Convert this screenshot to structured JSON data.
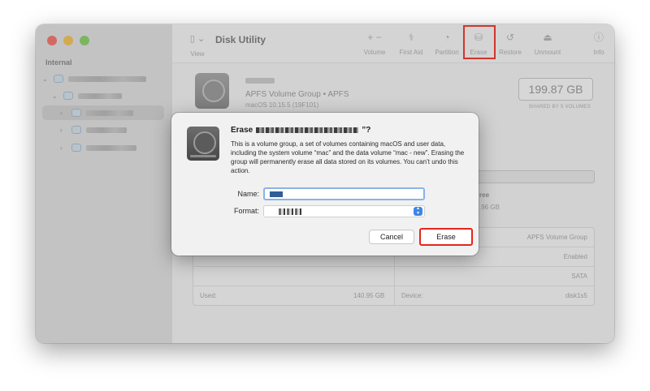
{
  "app": {
    "title": "Disk Utility"
  },
  "sidebar": {
    "heading": "Internal",
    "items": [
      {
        "level": 0,
        "selected": false
      },
      {
        "level": 1,
        "selected": false
      },
      {
        "level": 2,
        "selected": true
      },
      {
        "level": 1,
        "selected": false
      },
      {
        "level": 2,
        "selected": false
      }
    ]
  },
  "toolbar": {
    "view_label": "View",
    "items": [
      {
        "label": "Volume",
        "icon": "plus-minus-icon",
        "glyph": "+  −"
      },
      {
        "label": "First Aid",
        "icon": "stethoscope-icon",
        "glyph": "⚕"
      },
      {
        "label": "Partition",
        "icon": "pie-chart-icon",
        "glyph": "◔"
      },
      {
        "label": "Erase",
        "icon": "erase-disk-icon",
        "glyph": "⛁"
      },
      {
        "label": "Restore",
        "icon": "restore-icon",
        "glyph": "↺"
      },
      {
        "label": "Unmount",
        "icon": "unmount-icon",
        "glyph": "⏏"
      },
      {
        "label": "Info",
        "icon": "info-icon",
        "glyph": "ⓘ"
      }
    ],
    "highlight_color": "#e3261c"
  },
  "volume": {
    "type_line": "APFS Volume Group • APFS",
    "os_line": "macOS 10.15.5 (19F101)",
    "capacity": "199.87 GB",
    "shared_label": "SHARED BY 5 VOLUMES",
    "free_label": "ree",
    "free_value": ".96 GB"
  },
  "info_table": {
    "rows": [
      {
        "left_label": "",
        "left_value": "",
        "right_label": "",
        "right_value": "APFS Volume Group"
      },
      {
        "left_label": "",
        "left_value": "",
        "right_label": "",
        "right_value": "Enabled"
      },
      {
        "left_label": "",
        "left_value": "",
        "right_label": "",
        "right_value": "SATA"
      },
      {
        "left_label": "Used:",
        "left_value": "140.95 GB",
        "right_label": "Device:",
        "right_value": "disk1s5"
      }
    ]
  },
  "dialog": {
    "title_prefix": "Erase",
    "title_suffix": "”?",
    "body": "This is a volume group, a set of volumes containing macOS and user data, including the system volume “mac” and the data volume “mac - new”. Erasing the group will permanently erase all data stored on its volumes. You can’t undo this action.",
    "name_label": "Name:",
    "format_label": "Format:",
    "cancel_label": "Cancel",
    "erase_label": "Erase"
  },
  "colors": {
    "accent": "#3d86e8",
    "highlight": "#e3261c"
  }
}
